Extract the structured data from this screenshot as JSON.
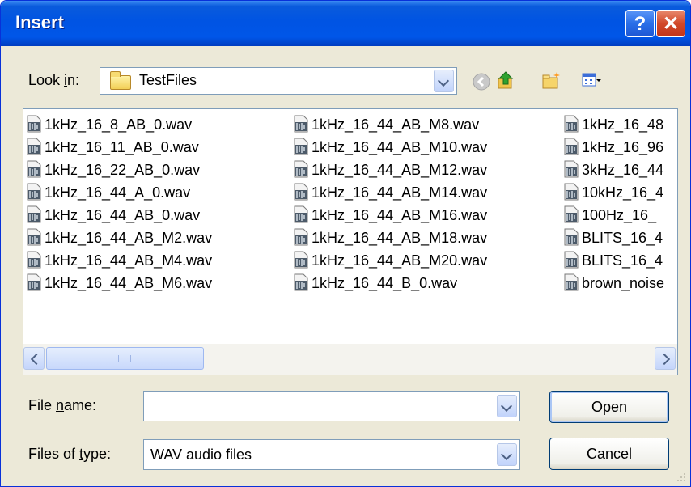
{
  "window": {
    "title": "Insert",
    "help_glyph": "?",
    "close_glyph": "✕"
  },
  "lookin": {
    "label_pre": "Look ",
    "label_key": "i",
    "label_post": "n:",
    "folder": "TestFiles"
  },
  "files": {
    "col1": [
      "1kHz_16_8_AB_0.wav",
      "1kHz_16_11_AB_0.wav",
      "1kHz_16_22_AB_0.wav",
      "1kHz_16_44_A_0.wav",
      "1kHz_16_44_AB_0.wav",
      "1kHz_16_44_AB_M2.wav",
      "1kHz_16_44_AB_M4.wav",
      "1kHz_16_44_AB_M6.wav"
    ],
    "col2": [
      "1kHz_16_44_AB_M8.wav",
      "1kHz_16_44_AB_M10.wav",
      "1kHz_16_44_AB_M12.wav",
      "1kHz_16_44_AB_M14.wav",
      "1kHz_16_44_AB_M16.wav",
      "1kHz_16_44_AB_M18.wav",
      "1kHz_16_44_AB_M20.wav",
      "1kHz_16_44_B_0.wav"
    ],
    "col3": [
      "1kHz_16_48",
      "1kHz_16_96",
      "3kHz_16_44",
      "10kHz_16_4",
      "100Hz_16_",
      "BLITS_16_4",
      "BLITS_16_4",
      "brown_noise"
    ]
  },
  "filename": {
    "label_pre": "File ",
    "label_key": "n",
    "label_post": "ame:",
    "value": ""
  },
  "filetype": {
    "label_pre": "Files of ",
    "label_key": "t",
    "label_post": "ype:",
    "value": "WAV audio files"
  },
  "buttons": {
    "open_key": "O",
    "open_rest": "pen",
    "cancel": "Cancel"
  },
  "colors": {
    "title_blue": "#0054e3",
    "face": "#ece9d8"
  }
}
